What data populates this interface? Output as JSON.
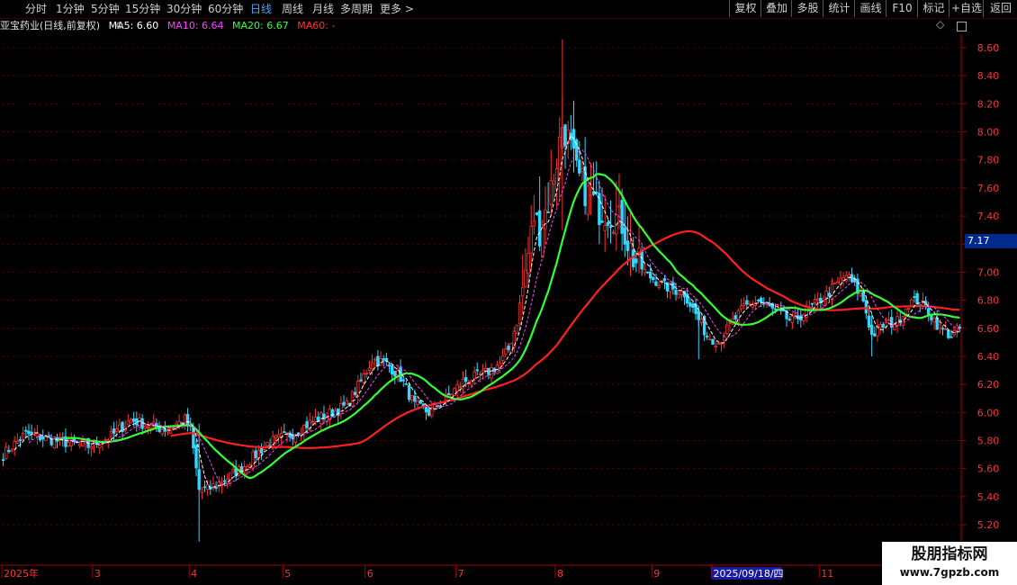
{
  "toolbar": {
    "periods": [
      "分时",
      "1分钟",
      "5分钟",
      "15分钟",
      "30分钟",
      "60分钟",
      "日线",
      "周线",
      "月线",
      "多周期",
      "更多 >"
    ],
    "active_period": "日线",
    "buttons": [
      "复权",
      "叠加",
      "多股",
      "统计",
      "画线",
      "F10",
      "标记",
      "+自选",
      "返回"
    ]
  },
  "info": {
    "stock": "亚宝药业(日线,前复权)",
    "ma5": "MA5: 6.60",
    "ma10": "MA10: 6.64",
    "ma20": "MA20: 6.67",
    "ma60": "MA60: -",
    "colors": {
      "stock": "#e0e0e0",
      "ma5": "#ffffff",
      "ma10": "#ff40ff",
      "ma20": "#33ff33",
      "ma60": "#ff3030"
    }
  },
  "current_price_tag": "7.17",
  "cursor_date": "2025/09/18/四",
  "watermark": {
    "title": "股朋指标网",
    "url": "www.7gpzb.com"
  },
  "chart_data": {
    "type": "candlestick",
    "y_ticks": [
      "8.60",
      "8.40",
      "8.20",
      "8.00",
      "7.80",
      "7.60",
      "7.40",
      "7.20",
      "7.00",
      "6.80",
      "6.60",
      "6.40",
      "6.20",
      "6.00",
      "5.80",
      "5.60",
      "5.40",
      "5.20"
    ],
    "ylim": [
      5.1,
      8.75
    ],
    "x_labels": [
      {
        "label": "2025年",
        "i": 0
      },
      {
        "label": "3",
        "i": 32
      },
      {
        "label": "4",
        "i": 66
      },
      {
        "label": "5",
        "i": 99
      },
      {
        "label": "6",
        "i": 128
      },
      {
        "label": "7",
        "i": 160
      },
      {
        "label": "8",
        "i": 195
      },
      {
        "label": "9",
        "i": 229
      },
      {
        "label": "2025/09/18/四",
        "i": 250
      },
      {
        "label": "11",
        "i": 288
      }
    ],
    "colors": {
      "up": "#ff3030",
      "down": "#33d6ff",
      "ma5": "#ffffff",
      "ma10": "#ff40ff",
      "ma20": "#33ff33",
      "ma60": "#ff2020",
      "grid": "#5a0000",
      "axis": "#a00000",
      "label": "#ff3333"
    },
    "controls": [
      {
        "i": 0,
        "p": 5.7
      },
      {
        "i": 8,
        "p": 5.85
      },
      {
        "i": 18,
        "p": 5.8
      },
      {
        "i": 30,
        "p": 5.76
      },
      {
        "i": 38,
        "p": 5.83
      },
      {
        "i": 45,
        "p": 5.95
      },
      {
        "i": 52,
        "p": 5.9
      },
      {
        "i": 58,
        "p": 5.88
      },
      {
        "i": 64,
        "p": 5.95
      },
      {
        "i": 66,
        "p": 5.88
      },
      {
        "i": 69,
        "p": 5.45
      },
      {
        "i": 72,
        "p": 5.45
      },
      {
        "i": 78,
        "p": 5.52
      },
      {
        "i": 85,
        "p": 5.62
      },
      {
        "i": 93,
        "p": 5.78
      },
      {
        "i": 102,
        "p": 5.85
      },
      {
        "i": 110,
        "p": 5.95
      },
      {
        "i": 116,
        "p": 6.0
      },
      {
        "i": 121,
        "p": 6.05
      },
      {
        "i": 126,
        "p": 6.22
      },
      {
        "i": 130,
        "p": 6.38
      },
      {
        "i": 135,
        "p": 6.35
      },
      {
        "i": 140,
        "p": 6.25
      },
      {
        "i": 145,
        "p": 6.05
      },
      {
        "i": 150,
        "p": 6.0
      },
      {
        "i": 156,
        "p": 6.1
      },
      {
        "i": 162,
        "p": 6.22
      },
      {
        "i": 170,
        "p": 6.28
      },
      {
        "i": 175,
        "p": 6.35
      },
      {
        "i": 178,
        "p": 6.45
      },
      {
        "i": 181,
        "p": 6.65
      },
      {
        "i": 184,
        "p": 7.0
      },
      {
        "i": 187,
        "p": 7.4
      },
      {
        "i": 189,
        "p": 7.3
      },
      {
        "i": 192,
        "p": 7.5
      },
      {
        "i": 195,
        "p": 7.8
      },
      {
        "i": 197,
        "p": 8.05
      },
      {
        "i": 199,
        "p": 7.95
      },
      {
        "i": 202,
        "p": 7.7
      },
      {
        "i": 206,
        "p": 7.55
      },
      {
        "i": 210,
        "p": 7.45
      },
      {
        "i": 214,
        "p": 7.42
      },
      {
        "i": 218,
        "p": 7.35
      },
      {
        "i": 222,
        "p": 7.1
      },
      {
        "i": 227,
        "p": 6.98
      },
      {
        "i": 233,
        "p": 6.9
      },
      {
        "i": 240,
        "p": 6.85
      },
      {
        "i": 244,
        "p": 6.7
      },
      {
        "i": 248,
        "p": 6.55
      },
      {
        "i": 252,
        "p": 6.5
      },
      {
        "i": 256,
        "p": 6.62
      },
      {
        "i": 261,
        "p": 6.75
      },
      {
        "i": 266,
        "p": 6.8
      },
      {
        "i": 272,
        "p": 6.72
      },
      {
        "i": 278,
        "p": 6.65
      },
      {
        "i": 283,
        "p": 6.72
      },
      {
        "i": 289,
        "p": 6.82
      },
      {
        "i": 294,
        "p": 6.92
      },
      {
        "i": 297,
        "p": 6.98
      },
      {
        "i": 300,
        "p": 6.9
      },
      {
        "i": 303,
        "p": 6.8
      },
      {
        "i": 306,
        "p": 6.55
      },
      {
        "i": 310,
        "p": 6.62
      },
      {
        "i": 315,
        "p": 6.65
      },
      {
        "i": 319,
        "p": 6.78
      },
      {
        "i": 322,
        "p": 6.8
      },
      {
        "i": 326,
        "p": 6.72
      },
      {
        "i": 330,
        "p": 6.6
      },
      {
        "i": 334,
        "p": 6.55
      },
      {
        "i": 337,
        "p": 6.6
      }
    ],
    "total_bars": 338
  }
}
